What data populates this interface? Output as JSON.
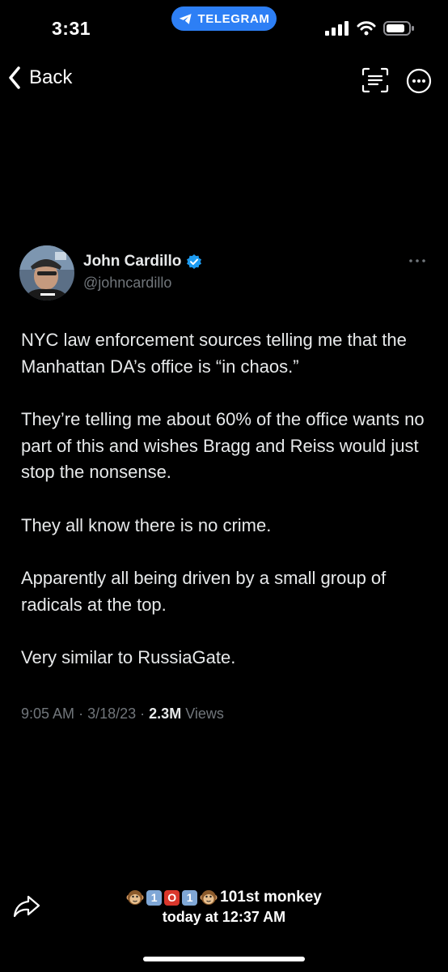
{
  "status_bar": {
    "time": "3:31",
    "telegram_label": "TELEGRAM"
  },
  "nav": {
    "back_label": "Back"
  },
  "tweet": {
    "author_name": "John Cardillo",
    "author_handle": "@johncardillo",
    "paragraphs": [
      "NYC law enforcement sources telling me that the Manhattan DA’s office is “in chaos.”",
      "They’re telling me about 60% of the office wants no part of this and wishes Bragg and Reiss would just stop the nonsense.",
      "They all know there is no crime.",
      "Apparently all being driven by a small group of radicals at the top.",
      "Very similar to RussiaGate."
    ],
    "time": "9:05 AM",
    "date": "3/18/23",
    "views_count": "2.3M",
    "views_label": "Views"
  },
  "footer": {
    "keycaps": [
      "1",
      "O",
      "1"
    ],
    "sender_name": "101st monkey",
    "timestamp": "today at 12:37 AM"
  },
  "colors": {
    "accent": "#2d7ff5",
    "verified": "#1d9bf0",
    "secondary_text": "#71767b"
  }
}
